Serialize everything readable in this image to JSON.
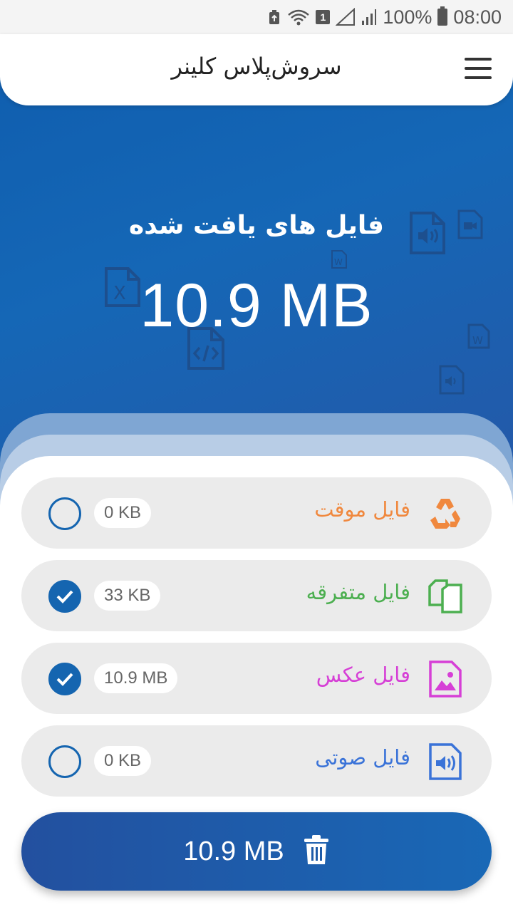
{
  "status_bar": {
    "sim_slot": "1",
    "battery": "100%",
    "time": "08:00"
  },
  "app_bar": {
    "title": "سروش‌پلاس کلینر",
    "menu_icon": "hamburger-menu-icon"
  },
  "summary": {
    "found_label": "فایل های یافت شده",
    "total_size": "10.9 MB"
  },
  "categories": [
    {
      "label": "فایل موقت",
      "size": "0 KB",
      "checked": false,
      "color": "#f0883e",
      "icon": "recycle-icon"
    },
    {
      "label": "فایل متفرقه",
      "size": "33 KB",
      "checked": true,
      "color": "#4caf50",
      "icon": "copy-files-icon"
    },
    {
      "label": "فایل عکس",
      "size": "10.9 MB",
      "checked": true,
      "color": "#d63fd6",
      "icon": "image-file-icon"
    },
    {
      "label": "فایل صوتی",
      "size": "0 KB",
      "checked": false,
      "color": "#3a73d8",
      "icon": "audio-file-icon"
    }
  ],
  "clean_button": {
    "label": "10.9 MB",
    "icon": "trash-icon"
  },
  "colors": {
    "primary": "#1565b0",
    "hero": "#1566b5"
  }
}
